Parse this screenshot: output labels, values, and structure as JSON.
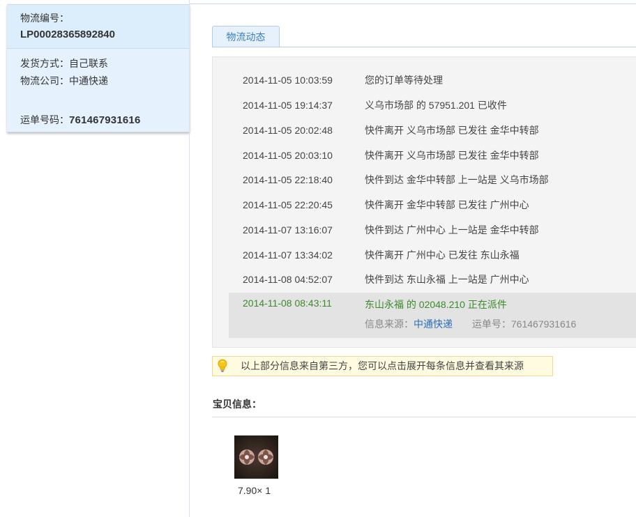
{
  "left": {
    "order_label": "物流编号：",
    "order_no": "LP00028365892840",
    "ship_method_label": "发货方式：",
    "ship_method": "自己联系",
    "company_label": "物流公司：",
    "company": "中通快递",
    "waybill_label": "运单号码：",
    "waybill_no": "761467931616"
  },
  "tab": {
    "label": "物流动态"
  },
  "tracking": [
    {
      "time": "2014-11-05 10:03:59",
      "desc": "您的订单等待处理"
    },
    {
      "time": "2014-11-05 19:14:37",
      "desc": "义乌市场部 的 57951.201 已收件"
    },
    {
      "time": "2014-11-05 20:02:48",
      "desc": "快件离开 义乌市场部 已发往 金华中转部"
    },
    {
      "time": "2014-11-05 20:03:10",
      "desc": "快件离开 义乌市场部 已发往 金华中转部"
    },
    {
      "time": "2014-11-05 22:18:40",
      "desc": "快件到达 金华中转部 上一站是 义乌市场部"
    },
    {
      "time": "2014-11-05 22:20:45",
      "desc": "快件离开 金华中转部 已发往 广州中心"
    },
    {
      "time": "2014-11-07 13:16:07",
      "desc": "快件到达 广州中心 上一站是 金华中转部"
    },
    {
      "time": "2014-11-07 13:34:02",
      "desc": "快件离开 广州中心 已发往 东山永福"
    },
    {
      "time": "2014-11-08 04:52:07",
      "desc": "快件到达 东山永福 上一站是 广州中心"
    }
  ],
  "tracking_last": {
    "time": "2014-11-08 08:43:11",
    "desc": "东山永福 的 02048.210 正在派件",
    "source_label": "信息来源：",
    "source_link": "中通快递",
    "waybill_label": "运单号：",
    "waybill_no": "761467931616"
  },
  "notice": {
    "text": "以上部分信息来自第三方，您可以点击展开每条信息并查看其来源",
    "icon": "lightbulb-icon"
  },
  "product": {
    "section_title": "宝贝信息：",
    "price_qty": "7.90× 1"
  },
  "colors": {
    "accent_blue": "#3a7fc0",
    "last_status_green": "#3b8a2a",
    "left_panel_bg": "#e5f1fc"
  }
}
